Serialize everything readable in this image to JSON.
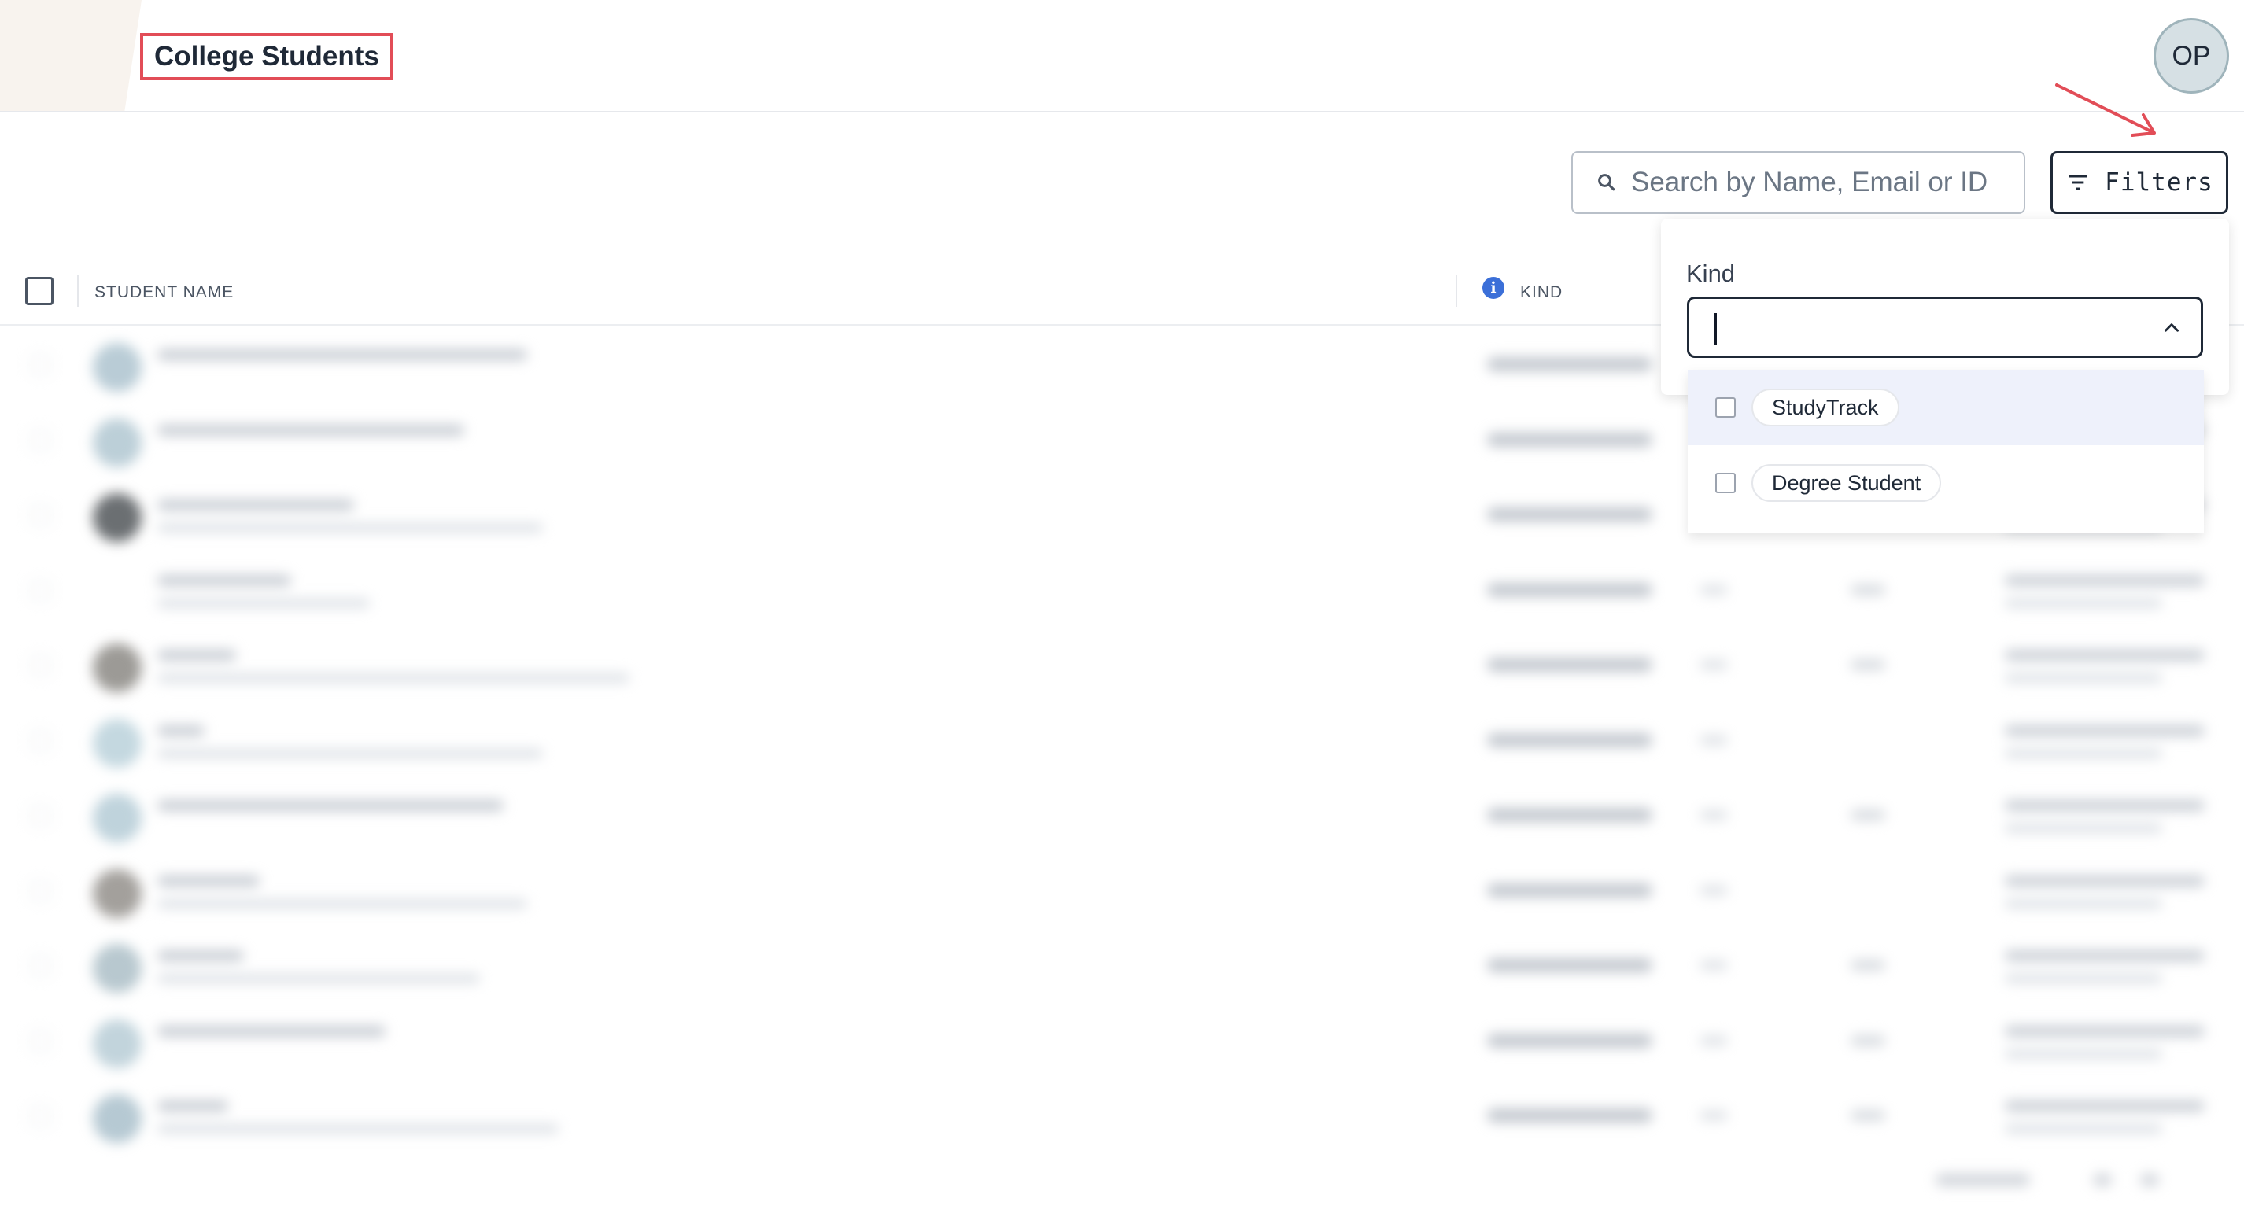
{
  "header": {
    "title": "College Students",
    "avatar_initials": "OP"
  },
  "toolbar": {
    "search_placeholder": "Search by Name, Email or ID",
    "filters_label": "Filters"
  },
  "table": {
    "columns": [
      "STUDENT NAME",
      "KIND"
    ]
  },
  "filter_panel": {
    "kind_label": "Kind",
    "kind_value": "",
    "options": [
      {
        "label": "StudyTrack",
        "checked": false,
        "highlighted": true
      },
      {
        "label": "Degree Student",
        "checked": false,
        "highlighted": false
      }
    ]
  },
  "colors": {
    "annotation": "#e24d57",
    "accent_info": "#3b6fd8",
    "highlight_bg": "#eef1fb"
  }
}
